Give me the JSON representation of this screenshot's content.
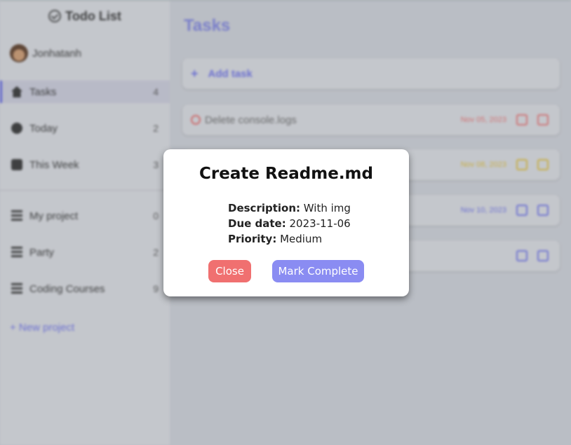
{
  "sidebar": {
    "brand": "Todo List",
    "user": "Jonhatanh",
    "nav": [
      {
        "label": "Tasks",
        "count": "4"
      },
      {
        "label": "Today",
        "count": "2"
      },
      {
        "label": "This Week",
        "count": "3"
      }
    ],
    "projects": [
      {
        "label": "My project",
        "count": "0"
      },
      {
        "label": "Party",
        "count": "2"
      },
      {
        "label": "Coding Courses",
        "count": "9"
      }
    ],
    "new_project": "+ New project"
  },
  "main": {
    "title": "Tasks",
    "add_task": "Add task",
    "tasks": [
      {
        "title": "Delete console.logs",
        "date": "Nov 05, 2023",
        "color": "#e07070"
      },
      {
        "title": "",
        "date": "Nov 08, 2023",
        "color": "#d8b838"
      },
      {
        "title": "",
        "date": "Nov 10, 2023",
        "color": "#6a6ee0"
      },
      {
        "title": "",
        "date": "",
        "color": "#6a6ee0"
      }
    ]
  },
  "modal": {
    "title": "Create Readme.md",
    "description_label": "Description:",
    "description": "With img",
    "due_label": "Due date:",
    "due": "2023-11-06",
    "priority_label": "Priority:",
    "priority": "Medium",
    "close": "Close",
    "complete": "Mark Complete"
  },
  "colors": {
    "accent": "#8a8cf2",
    "close": "#f07070"
  }
}
